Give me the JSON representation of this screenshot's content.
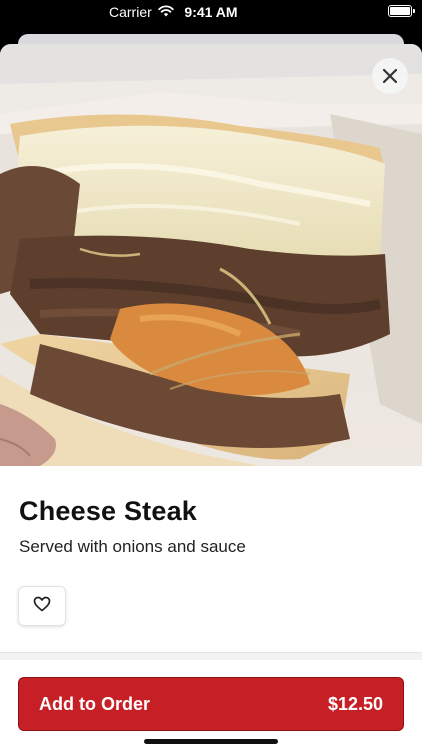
{
  "status_bar": {
    "carrier": "Carrier",
    "time": "9:41 AM"
  },
  "item": {
    "name": "Cheese Steak",
    "description": "Served with onions and sauce"
  },
  "actions": {
    "add_label": "Add to Order",
    "price": "$12.50"
  },
  "icons": {
    "close": "close-icon",
    "favorite": "heart-outline-icon",
    "wifi": "wifi-icon",
    "battery": "battery-icon"
  },
  "colors": {
    "accent": "#c62026",
    "accent_border": "#8f1014"
  }
}
